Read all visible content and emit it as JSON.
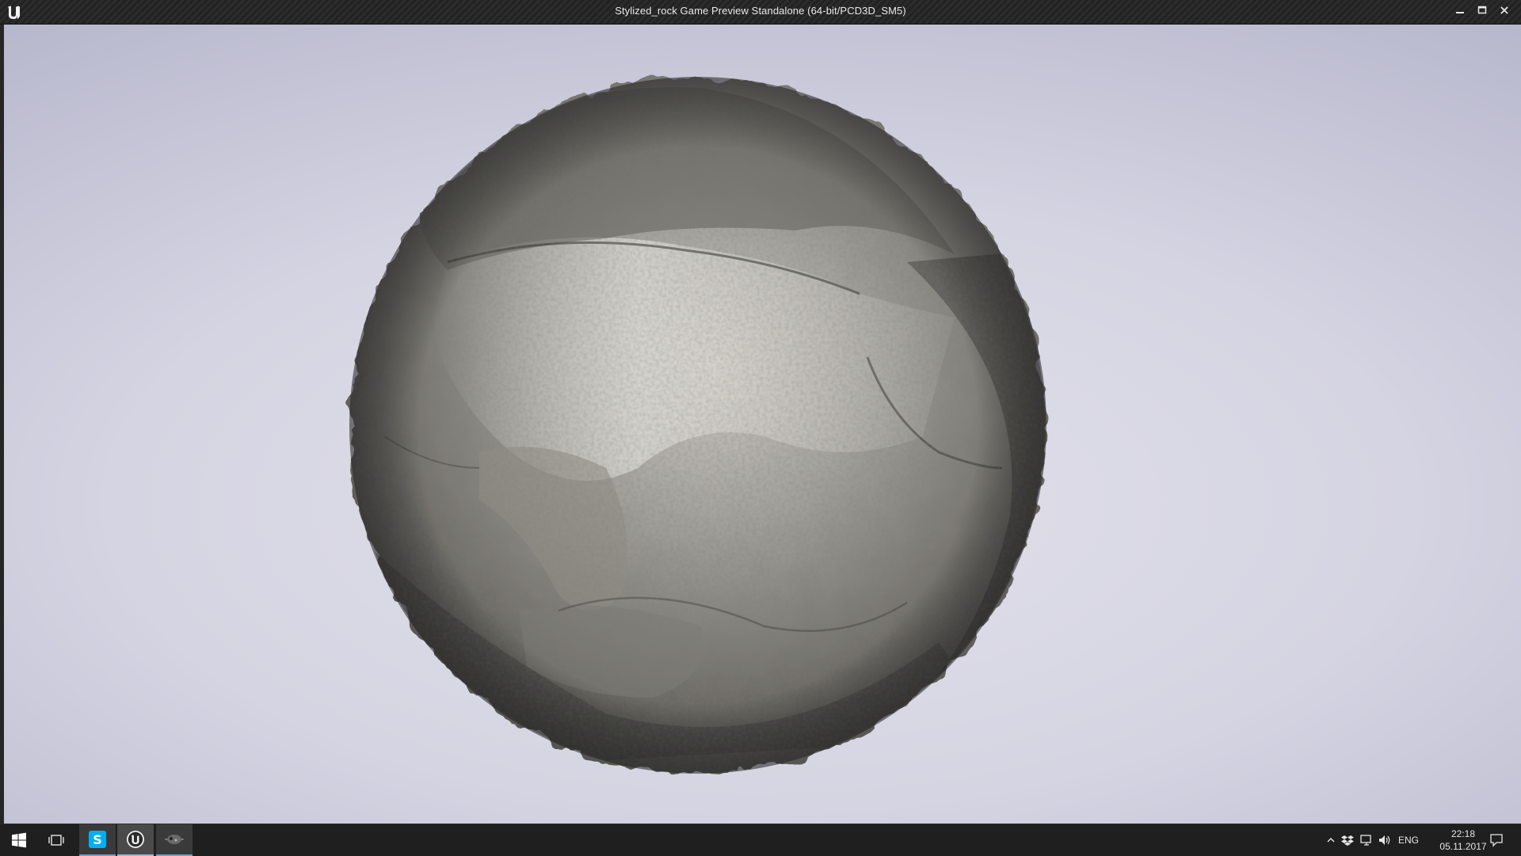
{
  "window": {
    "title": "Stylized_rock Game Preview Standalone (64-bit/PCD3D_SM5)",
    "icon": "unreal-logo-icon",
    "controls": [
      "minimize-icon",
      "maximize-icon",
      "close-icon"
    ]
  },
  "viewport": {
    "background_color": "#d4d3e0",
    "object": "stylized-rock-sphere"
  },
  "taskbar": {
    "apps": [
      {
        "name": "start",
        "icon": "windows-logo-icon"
      },
      {
        "name": "task-view",
        "icon": "task-view-icon"
      },
      {
        "name": "skype",
        "icon": "skype-icon",
        "accent": "#00aff0"
      },
      {
        "name": "unreal-editor",
        "icon": "unreal-logo-icon"
      },
      {
        "name": "game-preview",
        "icon": "game-preview-icon"
      }
    ],
    "tray": {
      "language": "ENG",
      "time": "22:18",
      "date": "05.11.2017",
      "icons": [
        "show-hidden-icons-chevron",
        "dropbox-icon",
        "network-icon",
        "volume-icon",
        "notifications-icon"
      ]
    }
  }
}
